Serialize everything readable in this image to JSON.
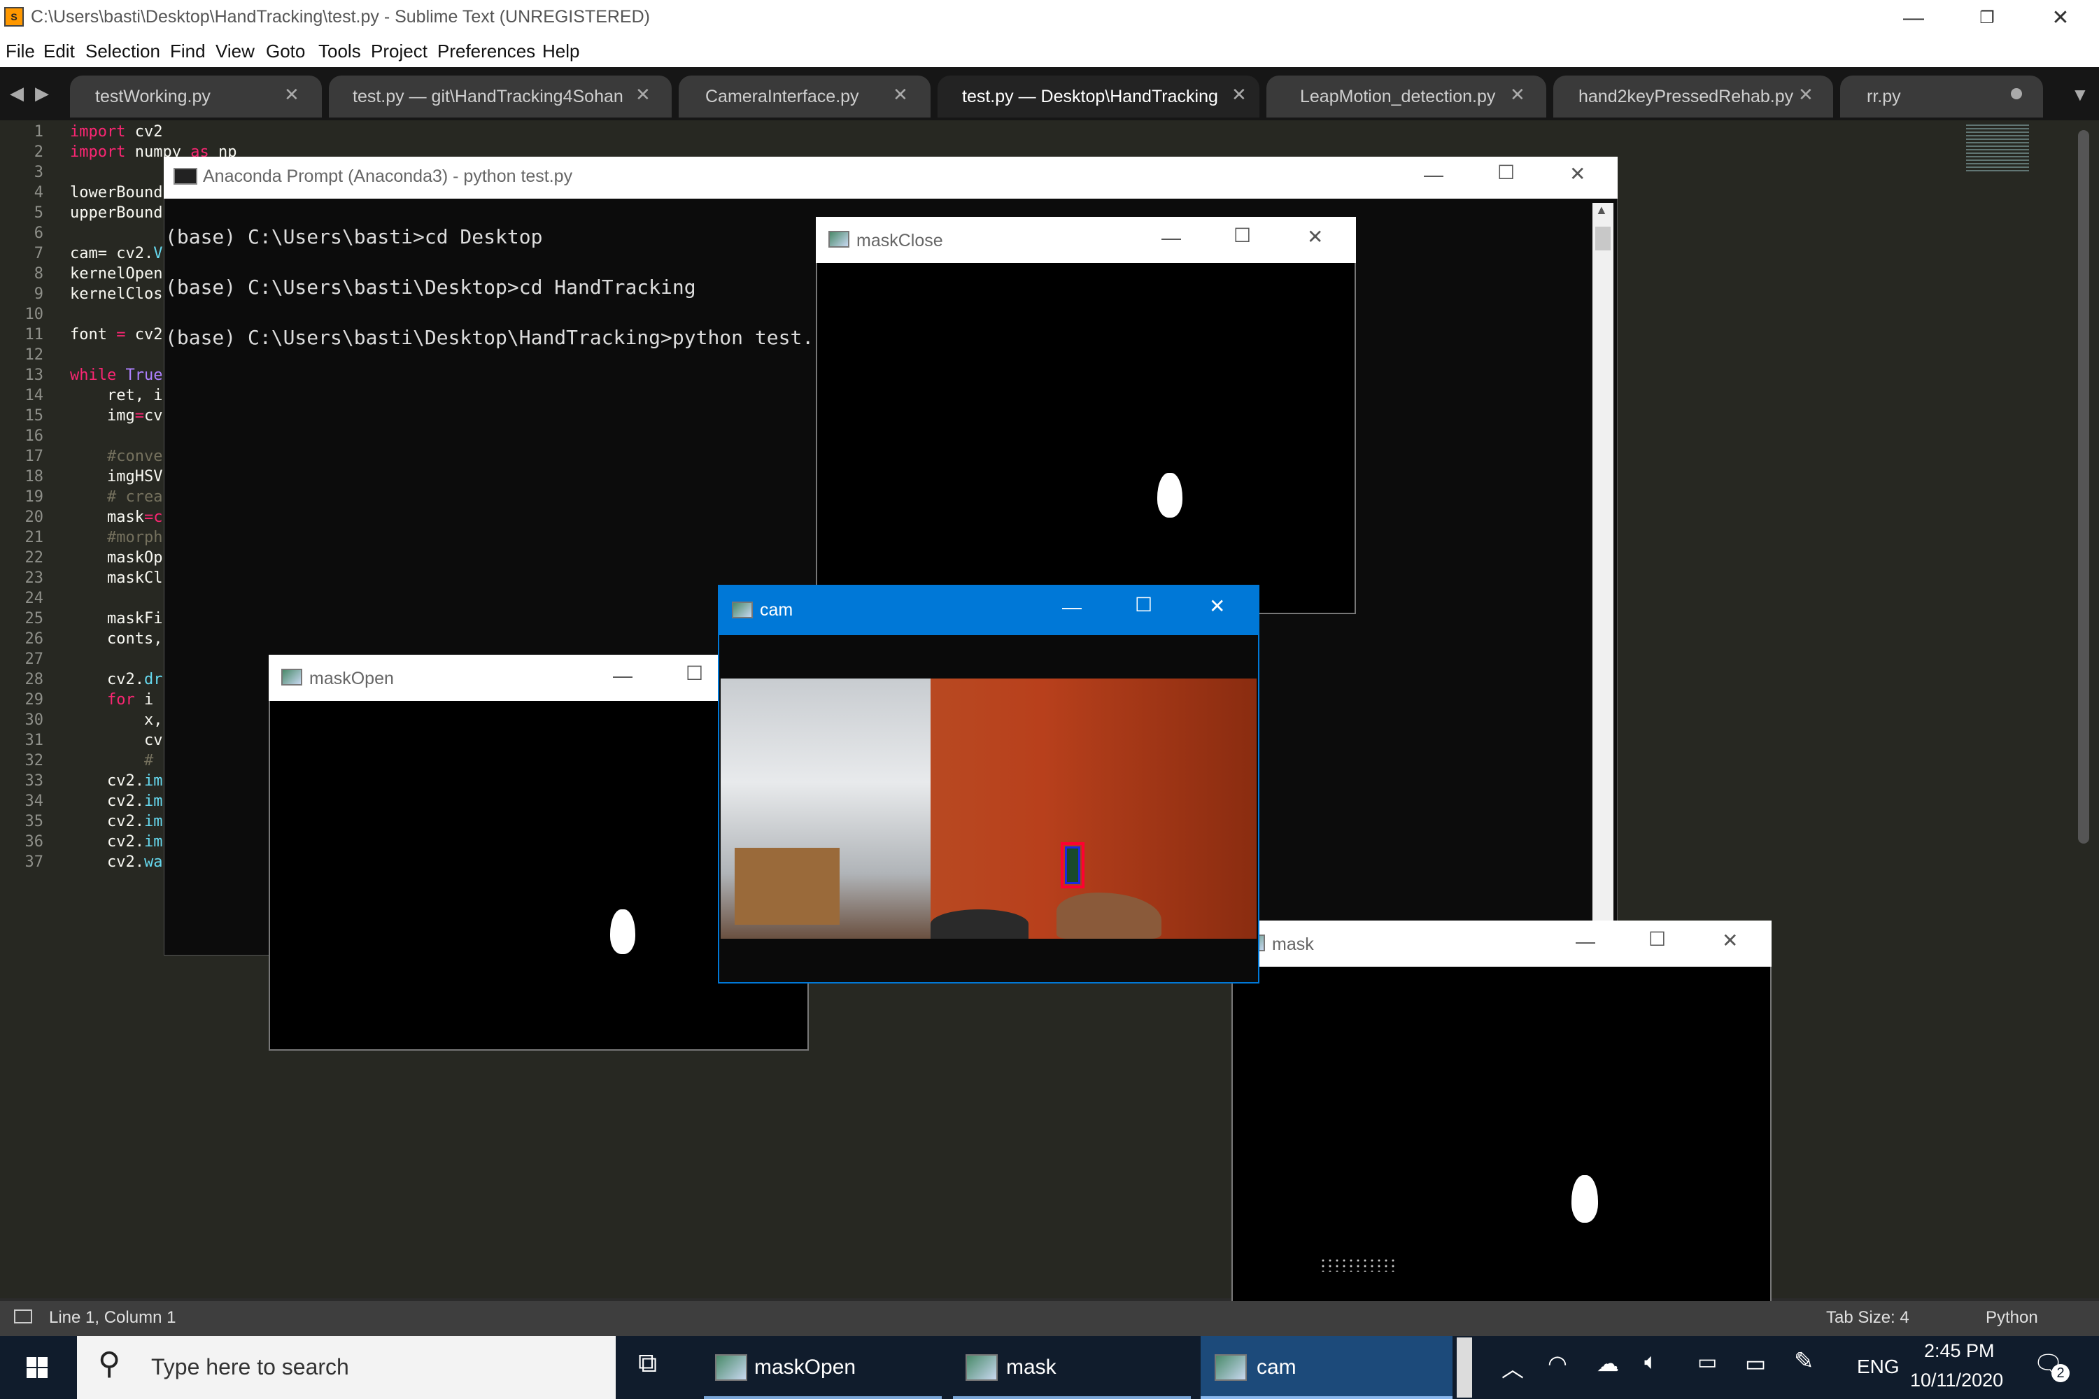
{
  "window": {
    "title": "C:\\Users\\basti\\Desktop\\HandTracking\\test.py - Sublime Text (UNREGISTERED)",
    "minimize": "—",
    "restore": "❐",
    "close": "✕"
  },
  "menu": [
    "File",
    "Edit",
    "Selection",
    "Find",
    "View",
    "Goto",
    "Tools",
    "Project",
    "Preferences",
    "Help"
  ],
  "tabs": [
    {
      "label": "testWorking.py"
    },
    {
      "label": "test.py — git\\HandTracking4Sohan"
    },
    {
      "label": "CameraInterface.py"
    },
    {
      "label": "test.py — Desktop\\HandTracking",
      "active": true
    },
    {
      "label": "LeapMotion_detection.py"
    },
    {
      "label": "hand2keyPressedRehab.py"
    },
    {
      "label": "rr.py",
      "dirty": true
    }
  ],
  "code_lines": {
    "n": [
      "1",
      "2",
      "3",
      "4",
      "5",
      "6",
      "7",
      "8",
      "9",
      "10",
      "11",
      "12",
      "13",
      "14",
      "15",
      "16",
      "17",
      "18",
      "19",
      "20",
      "21",
      "22",
      "23",
      "24",
      "25",
      "26",
      "27",
      "28",
      "29",
      "30",
      "31",
      "32",
      "33",
      "34",
      "35",
      "36",
      "37"
    ],
    "l1a": "import",
    "l1b": " cv2",
    "l2a": "import",
    "l2b": " numpy",
    "l2c": " as",
    "l2d": " np",
    "l4": "lowerBound",
    "l5": "upperBound",
    "l7a": "cam= cv2.",
    "l7b": "V",
    "l8": "kernelOpen",
    "l9": "kernelClos",
    "l11a": "font",
    "l11b": " = ",
    "l11c": "cv2",
    "l13a": "while",
    "l13b": " True",
    "l14": "    ret, i",
    "l15a": "    img",
    "l15b": "=",
    "l15c": "cv",
    "l17": "    #conve",
    "l18": "    imgHSV",
    "l19": "    # crea",
    "l20a": "    mask",
    "l20b": "=c",
    "l21": "    #morph",
    "l22": "    maskOp",
    "l23": "    maskCl",
    "l25": "    maskFi",
    "l26": "    conts,",
    "l28a": "    cv2.",
    "l28b": "dr",
    "l29a": "    for",
    "l29b": " i",
    "l30": "        x,",
    "l31": "        cv",
    "l32": "        #",
    "l33a": "    cv2.",
    "l33b": "im",
    "l34a": "    cv2.",
    "l34b": "im",
    "l35a": "    cv2.",
    "l35b": "im",
    "l36a": "    cv2.",
    "l36b": "im",
    "l37a": "    cv2.",
    "l37b": "wa"
  },
  "status": {
    "position": "Line 1, Column 1",
    "tab_size": "Tab Size: 4",
    "syntax": "Python"
  },
  "anaconda": {
    "title": "Anaconda Prompt (Anaconda3) - python  test.py",
    "lines": [
      "(base) C:\\Users\\basti>cd Desktop",
      "(base) C:\\Users\\basti\\Desktop>cd HandTracking",
      "(base) C:\\Users\\basti\\Desktop\\HandTracking>python test."
    ]
  },
  "windows": {
    "maskClose": "maskClose",
    "cam": "cam",
    "maskOpen": "maskOpen",
    "mask": "mask"
  },
  "taskbar": {
    "search_placeholder": "Type here to search",
    "apps": [
      "maskOpen",
      "mask",
      "cam"
    ],
    "lang": "ENG",
    "time": "2:45 PM",
    "date": "10/11/2020",
    "notifications": "2"
  },
  "colors": {
    "accent": "#0078d7",
    "editor_bg": "#272822",
    "taskbar": "#101c2c"
  }
}
